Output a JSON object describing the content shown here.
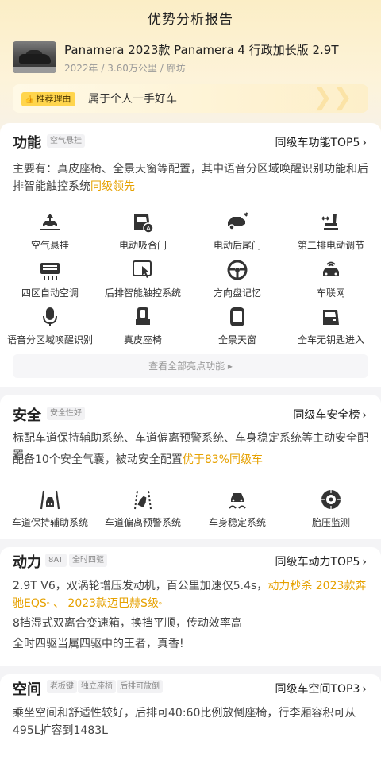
{
  "header": {
    "title": "优势分析报告"
  },
  "car": {
    "name": "Panamera 2023款 Panamera 4 行政加长版 2.9T",
    "meta": "2022年 / 3.60万公里 / 廊坊"
  },
  "reason": {
    "badge": "推荐理由",
    "text": "属于个人一手好车"
  },
  "function": {
    "title": "功能",
    "tag": "空气悬挂",
    "link": "同级车功能TOP5",
    "desc_main": "主要有：真皮座椅、全景天窗等配置，其中语音分区域唤醒识别功能和后排智能触控系统",
    "desc_hl": "同级领先",
    "features": [
      {
        "label": "空气悬挂",
        "icon": "air-suspension-icon"
      },
      {
        "label": "电动吸合门",
        "icon": "soft-close-door-icon"
      },
      {
        "label": "电动后尾门",
        "icon": "power-tailgate-icon"
      },
      {
        "label": "第二排电动调节",
        "icon": "power-seat-adjust-icon"
      },
      {
        "label": "四区自动空调",
        "icon": "climate-control-icon"
      },
      {
        "label": "后排智能触控系统",
        "icon": "touch-control-icon"
      },
      {
        "label": "方向盘记忆",
        "icon": "steering-memory-icon"
      },
      {
        "label": "车联网",
        "icon": "connected-car-icon"
      },
      {
        "label": "语音分区域唤醒识别",
        "icon": "microphone-icon"
      },
      {
        "label": "真皮座椅",
        "icon": "leather-seat-icon"
      },
      {
        "label": "全景天窗",
        "icon": "panoramic-sunroof-icon"
      },
      {
        "label": "全车无钥匙进入",
        "icon": "keyless-entry-icon"
      }
    ],
    "see_all": "查看全部亮点功能"
  },
  "safety": {
    "title": "安全",
    "tag": "安全性好",
    "link": "同级车安全榜",
    "desc1": "标配车道保持辅助系统、车道偏离预警系统、车身稳定系统等主动安全配置",
    "desc2_main": "配备10个安全气囊，被动安全配置",
    "desc2_hl": "优于83%同级车",
    "features": [
      {
        "label": "车道保持辅助系统",
        "icon": "lane-keep-icon"
      },
      {
        "label": "车道偏离预警系统",
        "icon": "lane-departure-icon"
      },
      {
        "label": "车身稳定系统",
        "icon": "stability-control-icon"
      },
      {
        "label": "胎压监测",
        "icon": "tire-pressure-icon"
      }
    ]
  },
  "power": {
    "title": "动力",
    "tags": [
      "8AT",
      "全时四驱"
    ],
    "link": "同级车动力TOP5",
    "desc1_main": "2.9T V6，双涡轮增压发动机，百公里加速仅5.4s，",
    "desc1_hl": "动力秒杀",
    "desc1_car1": "2023款奔驰EQS",
    "desc1_sep": "、",
    "desc1_car2": "2023款迈巴赫S级",
    "desc2": "8挡湿式双离合变速箱，换挡平顺，传动效率高",
    "desc3": "全时四驱当属四驱中的王者，真香!"
  },
  "space": {
    "title": "空间",
    "tags": [
      "老板键",
      "独立座椅",
      "后排可放倒"
    ],
    "link": "同级车空间TOP3",
    "desc": "乘坐空间和舒适性较好，后排可40:60比例放倒座椅，行李厢容积可从495L扩容到1483L"
  },
  "colors": {
    "accent": "#e6a100",
    "badge": "#ffd54d"
  }
}
